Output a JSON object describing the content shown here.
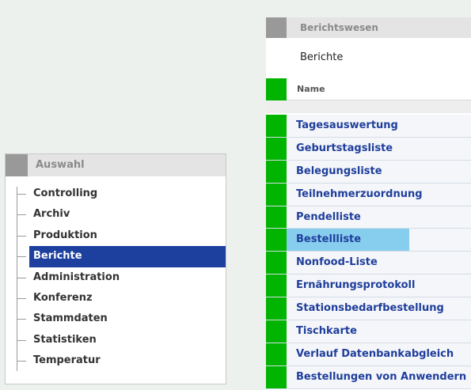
{
  "auswahl": {
    "title": "Auswahl",
    "items": [
      {
        "label": "Controlling",
        "active": false
      },
      {
        "label": "Archiv",
        "active": false
      },
      {
        "label": "Produktion",
        "active": false
      },
      {
        "label": "Berichte",
        "active": true
      },
      {
        "label": "Administration",
        "active": false
      },
      {
        "label": "Konferenz",
        "active": false
      },
      {
        "label": "Stammdaten",
        "active": false
      },
      {
        "label": "Statistiken",
        "active": false
      },
      {
        "label": "Temperatur",
        "active": false
      }
    ]
  },
  "berichtswesen": {
    "title": "Berichtswesen",
    "subtitle": "Berichte",
    "column_header": "Name",
    "rows": [
      {
        "label": "Tagesauswertung"
      },
      {
        "label": "Geburtstagsliste"
      },
      {
        "label": "Belegungsliste"
      },
      {
        "label": "Teilnehmerzuordnung"
      },
      {
        "label": "Pendelliste"
      },
      {
        "label": "Bestellliste",
        "highlighted": true
      },
      {
        "label": "Nonfood-Liste"
      },
      {
        "label": "Ernährungsprotokoll"
      },
      {
        "label": "Stationsbedarfbestellung"
      },
      {
        "label": "Tischkarte"
      },
      {
        "label": "Verlauf Datenbankabgleich"
      },
      {
        "label": "Bestellungen von Anwendern"
      }
    ]
  },
  "colors": {
    "page_background": "#ecf1ed",
    "status_green": "#00b400",
    "active_item_bg": "#1d3f9d",
    "link_text": "#1f3e9c",
    "row_highlight": "#87ceee"
  }
}
